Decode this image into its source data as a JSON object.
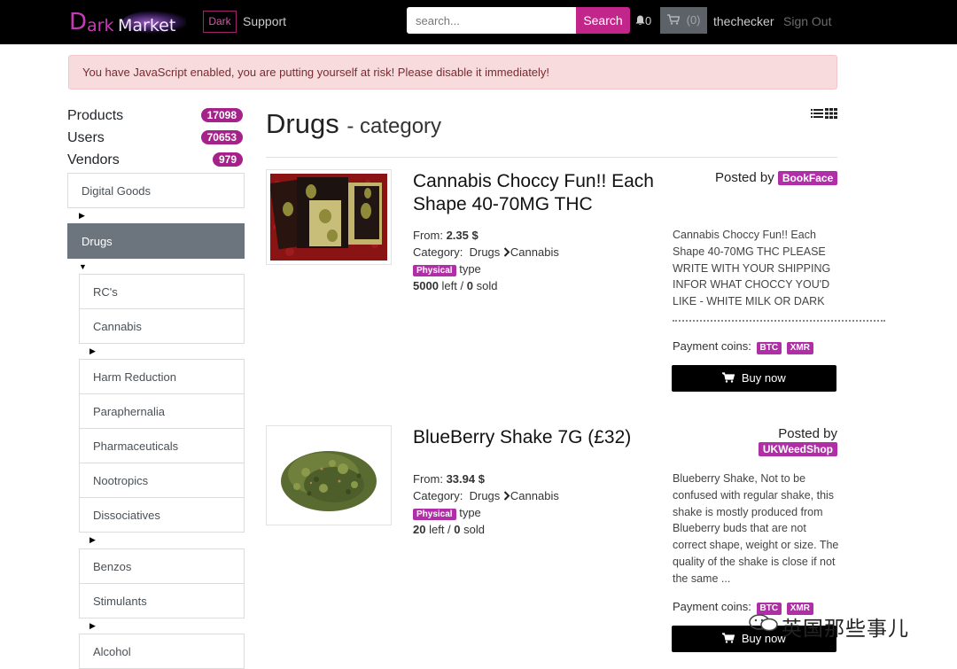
{
  "nav": {
    "logo": {
      "d": "D",
      "ark": "ark",
      "market": "Market"
    },
    "theme_label": "Dark",
    "support_label": "Support",
    "search_placeholder": "search...",
    "search_button": "Search",
    "bell_icon": "bell-icon",
    "notifications_count": "0",
    "cart_icon": "cart-icon",
    "cart_count": "(0)",
    "username": "thechecker",
    "signout_label": "Sign Out"
  },
  "alert": "You have JavaScript enabled, you are putting yourself at risk! Please disable it immediately!",
  "sidebar": {
    "stats": [
      {
        "label": "Products",
        "count": "17098"
      },
      {
        "label": "Users",
        "count": "70653"
      },
      {
        "label": "Vendors",
        "count": "979"
      }
    ],
    "categories": [
      {
        "label": "Digital Goods"
      },
      {
        "label": "Drugs",
        "active": true
      },
      {
        "label": "RC's"
      },
      {
        "label": "Cannabis"
      },
      {
        "label": "Harm Reduction"
      },
      {
        "label": "Paraphernalia"
      },
      {
        "label": "Pharmaceuticals"
      },
      {
        "label": "Nootropics"
      },
      {
        "label": "Dissociatives"
      },
      {
        "label": "Benzos"
      },
      {
        "label": "Stimulants"
      },
      {
        "label": "Alcohol"
      }
    ],
    "arrows": {
      "collapsed": "▶",
      "expanded": "▼"
    }
  },
  "main": {
    "title": "Drugs",
    "subtitle": "- category",
    "products": [
      {
        "title_line1": "Cannabis Choccy Fun!! Each",
        "title_line2": "Shape 40-70MG THC",
        "posted_by_label": "Posted by",
        "vendor": "BookFace",
        "from_label": "From:",
        "price": "2.35 $",
        "category_label": "Category:",
        "category_parent": "Drugs",
        "category_child": "Cannabis",
        "type_badge": "Physical",
        "type_label": "type",
        "left": "5000",
        "left_label": "left /",
        "sold": "0",
        "sold_label": "sold",
        "description": "Cannabis Choccy Fun!! Each Shape 40-70MG THC PLEASE WRITE WITH YOUR SHIPPING INFOR WHAT CHOCCY YOU'D LIKE - WHITE MILK OR DARK",
        "payment_label": "Payment coins:",
        "coins": [
          "BTC",
          "XMR"
        ],
        "buy_label": "Buy now"
      },
      {
        "title_line1": "BlueBerry Shake 7G (£32)",
        "title_line2": "",
        "posted_by_label": "Posted by",
        "vendor": "UKWeedShop",
        "from_label": "From:",
        "price": "33.94 $",
        "category_label": "Category:",
        "category_parent": "Drugs",
        "category_child": "Cannabis",
        "type_badge": "Physical",
        "type_label": "type",
        "left": "20",
        "left_label": "left /",
        "sold": "0",
        "sold_label": "sold",
        "description": "Blueberry Shake, Not to be confused with regular shake, this shake is mostly produced from Blueberry buds that are not correct shape, weight or size. The quality of the shake is close if not the same ...",
        "payment_label": "Payment coins:",
        "coins": [
          "BTC",
          "XMR"
        ],
        "buy_label": "Buy now"
      }
    ]
  },
  "watermark": "英国那些事儿",
  "colors": {
    "accent": "#b02fa6",
    "navbar": "#000000",
    "alert_bg": "#f8dbdc",
    "active_category": "#6c757d"
  }
}
